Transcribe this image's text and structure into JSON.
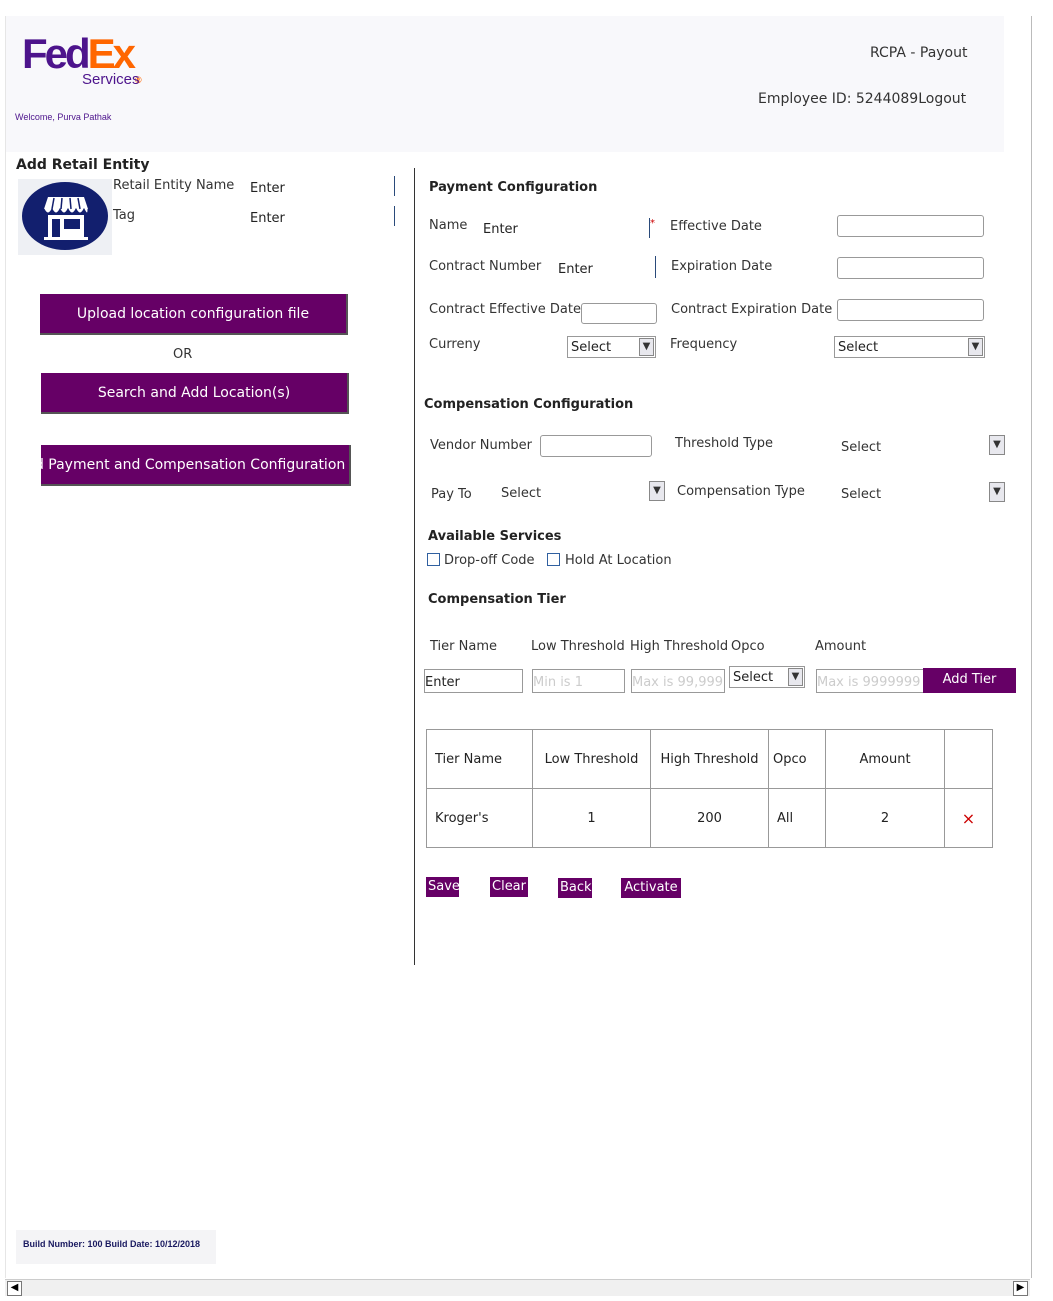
{
  "header": {
    "logo_fed": "Fed",
    "logo_ex": "Ex",
    "logo_services": "Services",
    "welcome": "Welcome, Purva Pathak",
    "app_name": "RCPA - Payout",
    "employee_id": "Employee ID: 5244089",
    "logout": "Logout"
  },
  "left": {
    "title": "Add Retail Entity",
    "entity_name_label": "Retail Entity Name",
    "entity_name_value": "Enter",
    "tag_label": "Tag",
    "tag_value": "Enter",
    "upload_button": "Upload location configuration file",
    "or_text": "OR",
    "search_button": "Search and Add Location(s)",
    "add_payment_button": "Add Payment and Compensation Configuration"
  },
  "payment": {
    "title": "Payment Configuration",
    "name_label": "Name",
    "name_value": "Enter",
    "required_mark": "*",
    "effective_date_label": "Effective Date",
    "contract_number_label": "Contract Number",
    "contract_number_value": "Enter",
    "expiration_date_label": "Expiration Date",
    "contract_effective_date_label": "Contract Effective Date",
    "contract_expiration_date_label": "Contract Expiration Date",
    "currency_label": "Curreny",
    "currency_value": "Select",
    "frequency_label": "Frequency",
    "frequency_value": "Select"
  },
  "compensation": {
    "title": "Compensation Configuration",
    "vendor_number_label": "Vendor Number",
    "threshold_type_label": "Threshold Type",
    "threshold_type_value": "Select",
    "pay_to_label": "Pay To",
    "pay_to_value": "Select",
    "compensation_type_label": "Compensation Type",
    "compensation_type_value": "Select"
  },
  "services": {
    "title": "Available Services",
    "dropoff_label": "Drop-off Code",
    "hold_label": "Hold At Location"
  },
  "tier": {
    "title": "Compensation Tier",
    "tier_name_label": "Tier Name",
    "low_threshold_label": "Low Threshold",
    "high_threshold_label": "High Threshold",
    "opco_label": "Opco",
    "amount_label": "Amount",
    "tier_name_value": "Enter",
    "low_placeholder": "Min is 1",
    "high_placeholder": "Max is 99,999",
    "opco_value": "Select",
    "amount_placeholder": "Max is 9999999",
    "add_tier_button": "Add Tier"
  },
  "table": {
    "headers": [
      "Tier Name",
      "Low Threshold",
      "High Threshold",
      "Opco",
      "Amount",
      ""
    ],
    "rows": [
      {
        "tier_name": "Kroger's",
        "low": "1",
        "high": "200",
        "opco": "All",
        "amount": "2",
        "delete": "×"
      }
    ]
  },
  "actions": {
    "save": "Save",
    "clear": "Clear",
    "back": "Back",
    "activate": "Activate"
  },
  "footer": {
    "build": "Build Number: 100 Build Date: 10/12/2018"
  },
  "icons": {
    "dropdown_arrow": "chevron-down-icon",
    "store": "store-icon",
    "delete": "close-icon",
    "scroll_left": "arrow-left-icon",
    "scroll_right": "arrow-right-icon"
  },
  "colors": {
    "brand_purple": "#4d148c",
    "brand_orange": "#ff6600",
    "button_purple": "#660066",
    "delete_red": "#cc0000"
  }
}
